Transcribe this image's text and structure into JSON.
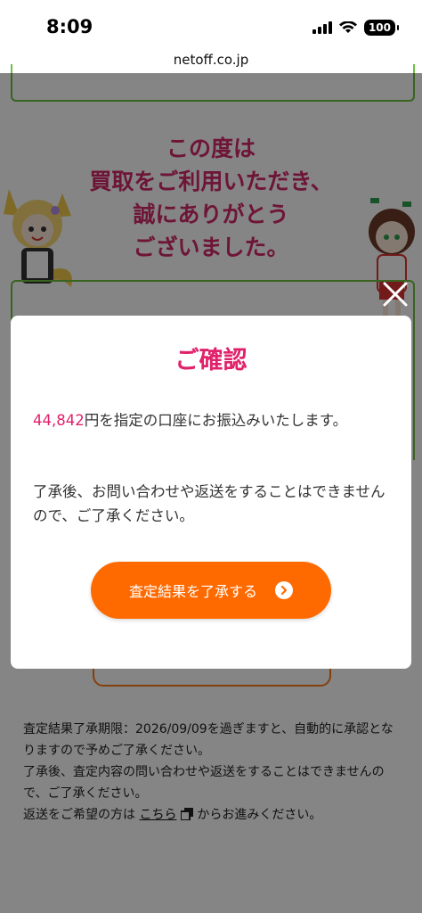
{
  "status_bar": {
    "time": "8:09",
    "battery": "100"
  },
  "browser": {
    "url": "netoff.co.jp"
  },
  "page": {
    "thanks_lines": [
      "この度は",
      "買取をご利用いただき、",
      "誠にありがとう",
      "ございました。"
    ],
    "notes": {
      "line1": "査定結果了承期限：2026/09/09を過ぎますと、自動的に承認となりますので予めご了承ください。",
      "line2": "了承後、査定内容の問い合わせや返送をすることはできませんので、ご了承ください。",
      "line3_prefix": "返送をご希望の方は ",
      "line3_link": "こちら",
      "line3_suffix": " からお進みください。"
    }
  },
  "modal": {
    "title": "ご確認",
    "amount": "44,842",
    "text1_suffix": "円を指定の口座にお振込みいたします。",
    "text2": "了承後、お問い合わせや返送をすることはできませんので、ご了承ください。",
    "button_label": "査定結果を了承する"
  },
  "colors": {
    "accent": "#e0216b",
    "button": "#ff6a00",
    "green": "#6cbf3f"
  }
}
